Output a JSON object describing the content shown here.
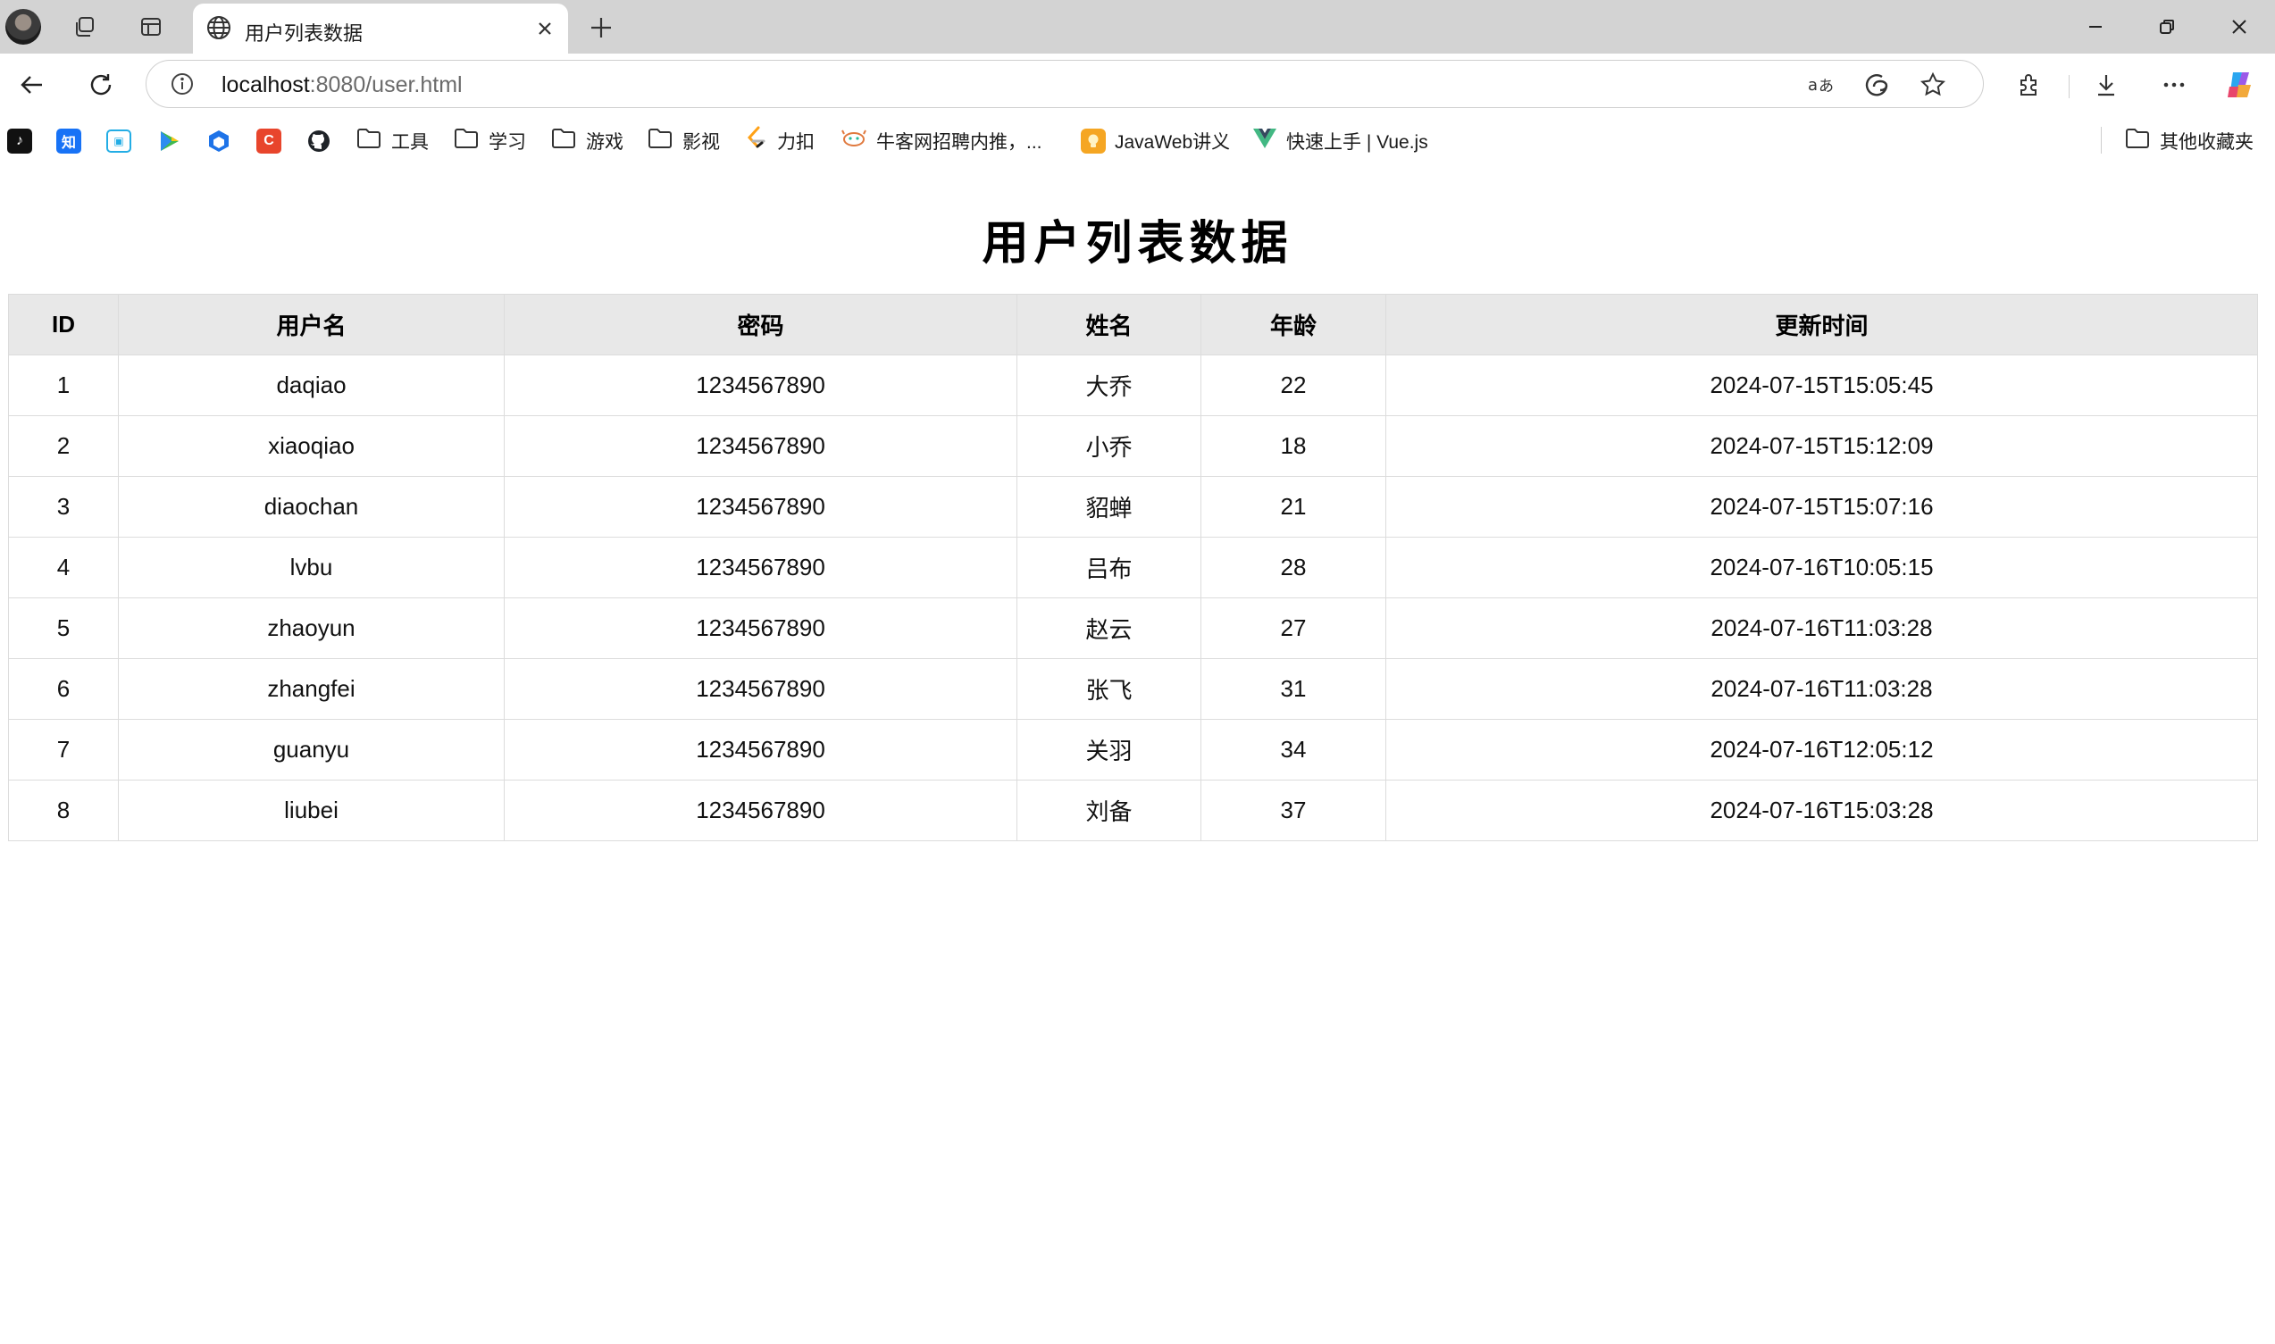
{
  "browser": {
    "tab": {
      "title": "用户列表数据"
    },
    "address": {
      "host": "localhost",
      "path": ":8080/user.html"
    },
    "bookmarks": [
      {
        "label": "",
        "icon": "tiktok-icon",
        "color": "#111111",
        "glyph": "♪"
      },
      {
        "label": "",
        "icon": "zhihu-icon",
        "color": "#1772f6",
        "glyph": "知"
      },
      {
        "label": "",
        "icon": "bilibili-icon",
        "color": "#23ade5",
        "glyph": "▣"
      },
      {
        "label": "",
        "icon": "play-icon",
        "color": "#3fb950",
        "glyph": "▶"
      },
      {
        "label": "",
        "icon": "cube-icon",
        "color": "#1e73e8",
        "glyph": "⬢"
      },
      {
        "label": "",
        "icon": "csdn-icon",
        "color": "#e8452c",
        "glyph": "C"
      },
      {
        "label": "",
        "icon": "github-icon",
        "color": "#1f2328",
        "glyph": "●"
      },
      {
        "label": "工具",
        "icon": "folder-icon"
      },
      {
        "label": "学习",
        "icon": "folder-icon"
      },
      {
        "label": "游戏",
        "icon": "folder-icon"
      },
      {
        "label": "影视",
        "icon": "folder-icon"
      },
      {
        "label": "力扣",
        "icon": "leetcode-icon",
        "color": "#ffa116"
      },
      {
        "label": "牛客网招聘内推，...",
        "icon": "nowcoder-icon",
        "color": "#25bb9b"
      },
      {
        "label": "JavaWeb讲义",
        "icon": "bulb-icon",
        "color": "#f5a623"
      },
      {
        "label": "快速上手 | Vue.js",
        "icon": "vue-icon",
        "color": "#42b883"
      }
    ],
    "other_bookmarks": "其他收藏夹"
  },
  "page": {
    "title": "用户列表数据",
    "table": {
      "headers": [
        "ID",
        "用户名",
        "密码",
        "姓名",
        "年龄",
        "更新时间"
      ],
      "rows": [
        [
          "1",
          "daqiao",
          "1234567890",
          "大乔",
          "22",
          "2024-07-15T15:05:45"
        ],
        [
          "2",
          "xiaoqiao",
          "1234567890",
          "小乔",
          "18",
          "2024-07-15T15:12:09"
        ],
        [
          "3",
          "diaochan",
          "1234567890",
          "貂蝉",
          "21",
          "2024-07-15T15:07:16"
        ],
        [
          "4",
          "lvbu",
          "1234567890",
          "吕布",
          "28",
          "2024-07-16T10:05:15"
        ],
        [
          "5",
          "zhaoyun",
          "1234567890",
          "赵云",
          "27",
          "2024-07-16T11:03:28"
        ],
        [
          "6",
          "zhangfei",
          "1234567890",
          "张飞",
          "31",
          "2024-07-16T11:03:28"
        ],
        [
          "7",
          "guanyu",
          "1234567890",
          "关羽",
          "34",
          "2024-07-16T12:05:12"
        ],
        [
          "8",
          "liubei",
          "1234567890",
          "刘备",
          "37",
          "2024-07-16T15:03:28"
        ]
      ]
    }
  }
}
